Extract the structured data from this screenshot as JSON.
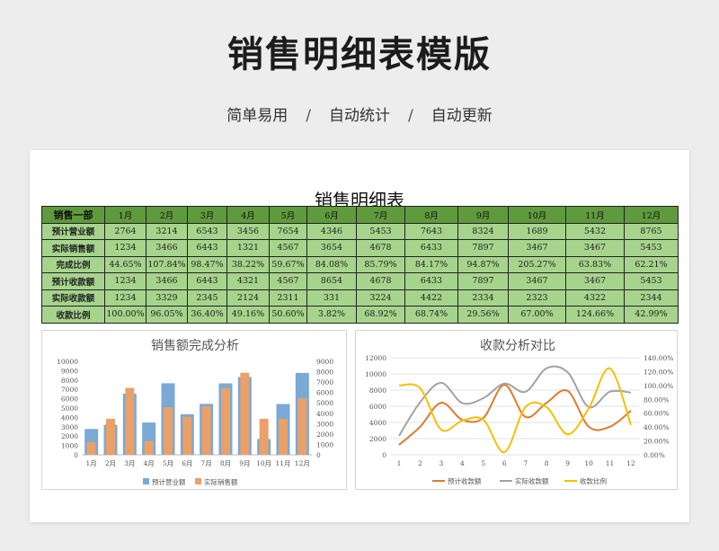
{
  "page": {
    "title": "销售明细表模版",
    "subtitle": [
      "简单易用",
      "自动统计",
      "自动更新"
    ],
    "separator": "/"
  },
  "sheet": {
    "title": "销售明细表",
    "header": [
      "销售一部",
      "1月",
      "2月",
      "3月",
      "4月",
      "5月",
      "6月",
      "7月",
      "8月",
      "9月",
      "10月",
      "11月",
      "12月"
    ],
    "rows": [
      [
        "预计营业额",
        "2764",
        "3214",
        "6543",
        "3456",
        "7654",
        "4346",
        "5453",
        "7643",
        "8324",
        "1689",
        "5432",
        "8765"
      ],
      [
        "实际销售额",
        "1234",
        "3466",
        "6443",
        "1321",
        "4567",
        "3654",
        "4678",
        "6433",
        "7897",
        "3467",
        "3467",
        "5453"
      ],
      [
        "完成比例",
        "44.65%",
        "107.84%",
        "98.47%",
        "38.22%",
        "59.67%",
        "84.08%",
        "85.79%",
        "84.17%",
        "94.87%",
        "205.27%",
        "63.83%",
        "62.21%"
      ],
      [
        "预计收款额",
        "1234",
        "3466",
        "6443",
        "4321",
        "4567",
        "8654",
        "4678",
        "6433",
        "7897",
        "3467",
        "3467",
        "5453"
      ],
      [
        "实际收款额",
        "1234",
        "3329",
        "2345",
        "2124",
        "2311",
        "331",
        "3224",
        "4422",
        "2334",
        "2323",
        "4322",
        "2344"
      ],
      [
        "收款比例",
        "100.00%",
        "96.05%",
        "36.40%",
        "49.16%",
        "50.60%",
        "3.82%",
        "68.92%",
        "68.74%",
        "29.56%",
        "67.00%",
        "124.66%",
        "42.99%"
      ]
    ]
  },
  "chart_data": [
    {
      "type": "bar",
      "title": "销售额完成分析",
      "categories": [
        "1月",
        "2月",
        "3月",
        "4月",
        "5月",
        "6月",
        "7月",
        "8月",
        "9月",
        "10月",
        "11月",
        "12月"
      ],
      "series": [
        {
          "name": "预计营业额",
          "values": [
            2764,
            3214,
            6543,
            3456,
            7654,
            4346,
            5453,
            7643,
            8324,
            1689,
            5432,
            8765
          ],
          "color": "#7aa9d6",
          "axis": "left"
        },
        {
          "name": "实际销售额",
          "values": [
            1234,
            3466,
            6443,
            1321,
            4567,
            3654,
            4678,
            6433,
            7897,
            3467,
            3467,
            5453
          ],
          "color": "#eba067",
          "axis": "right"
        }
      ],
      "ylim_left": [
        0,
        10000
      ],
      "yticks_left": [
        "0",
        "1000",
        "2000",
        "3000",
        "4000",
        "5000",
        "6000",
        "7000",
        "8000",
        "9000",
        "10000"
      ],
      "ylim_right": [
        0,
        9000
      ],
      "yticks_right": [
        "0",
        "1000",
        "2000",
        "3000",
        "4000",
        "5000",
        "6000",
        "7000",
        "8000",
        "9000"
      ],
      "legend": "bottom",
      "grid": false
    },
    {
      "type": "line",
      "title": "收款分析对比",
      "x": [
        "1",
        "2",
        "3",
        "4",
        "5",
        "6",
        "7",
        "8",
        "9",
        "10",
        "11",
        "12"
      ],
      "series": [
        {
          "name": "预计收款额",
          "values": [
            1234,
            3466,
            6443,
            4321,
            4567,
            8654,
            4678,
            6433,
            7897,
            3467,
            3467,
            5453
          ],
          "color": "#e07b2e",
          "axis": "left"
        },
        {
          "name": "实际收款额",
          "values": [
            2345,
            6500,
            8900,
            6400,
            7000,
            8800,
            7800,
            10700,
            10200,
            5900,
            7800,
            7700
          ],
          "color": "#a3a3a3",
          "axis": "left"
        },
        {
          "name": "收款比例",
          "values": [
            100.0,
            96.05,
            36.4,
            49.16,
            50.6,
            3.82,
            68.92,
            68.74,
            29.56,
            67.0,
            124.66,
            42.99
          ],
          "color": "#f2c200",
          "axis": "right"
        }
      ],
      "ylim_left": [
        0,
        12000
      ],
      "yticks_left": [
        "0",
        "2000",
        "4000",
        "6000",
        "8000",
        "10000",
        "12000"
      ],
      "ylim_right": [
        0,
        140
      ],
      "yticks_right": [
        "0.00%",
        "20.00%",
        "40.00%",
        "60.00%",
        "80.00%",
        "100.00%",
        "120.00%",
        "140.00%"
      ],
      "legend": "bottom",
      "grid": true
    }
  ]
}
